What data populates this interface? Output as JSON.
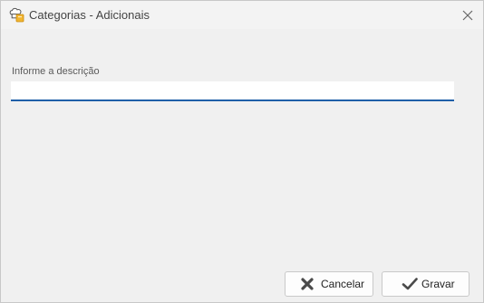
{
  "window": {
    "title": "Categorias - Adicionais"
  },
  "form": {
    "description_label": "Informe a descrição",
    "description_value": ""
  },
  "buttons": {
    "cancel_label": "Cancelar",
    "save_label": "Gravar"
  },
  "icons": {
    "app": "chef-hat-icon",
    "close": "close-icon",
    "cancel": "x-mark-icon",
    "save": "check-mark-icon"
  },
  "colors": {
    "input_underline": "#1f5fa8",
    "window_bg": "#f0f0f0",
    "button_bg": "#fdfdfd"
  }
}
